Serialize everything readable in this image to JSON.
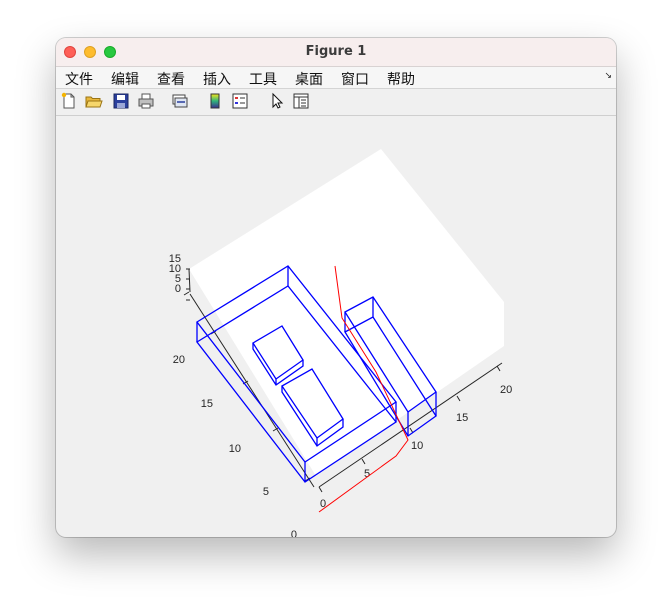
{
  "window": {
    "title": "Figure 1"
  },
  "menu": {
    "items": [
      "文件",
      "编辑",
      "查看",
      "插入",
      "工具",
      "桌面",
      "窗口",
      "帮助"
    ],
    "dock_glyph": "↘"
  },
  "toolbar": {
    "buttons": [
      "new-figure-icon",
      "open-file-icon",
      "save-icon",
      "print-icon",
      "link-axes-icon",
      "colorbar-icon",
      "legend-icon",
      "select-pointer-icon",
      "property-inspector-icon"
    ]
  },
  "plot": {
    "colors": {
      "boxes": "#0000ff",
      "path": "#ff0000",
      "plane": "#ffffff"
    },
    "z_ticks": [
      "0",
      "5",
      "10",
      "15"
    ],
    "y_ticks": [
      "0",
      "5",
      "10",
      "15",
      "20"
    ],
    "x_ticks": [
      "0",
      "5",
      "10",
      "15",
      "20"
    ]
  }
}
